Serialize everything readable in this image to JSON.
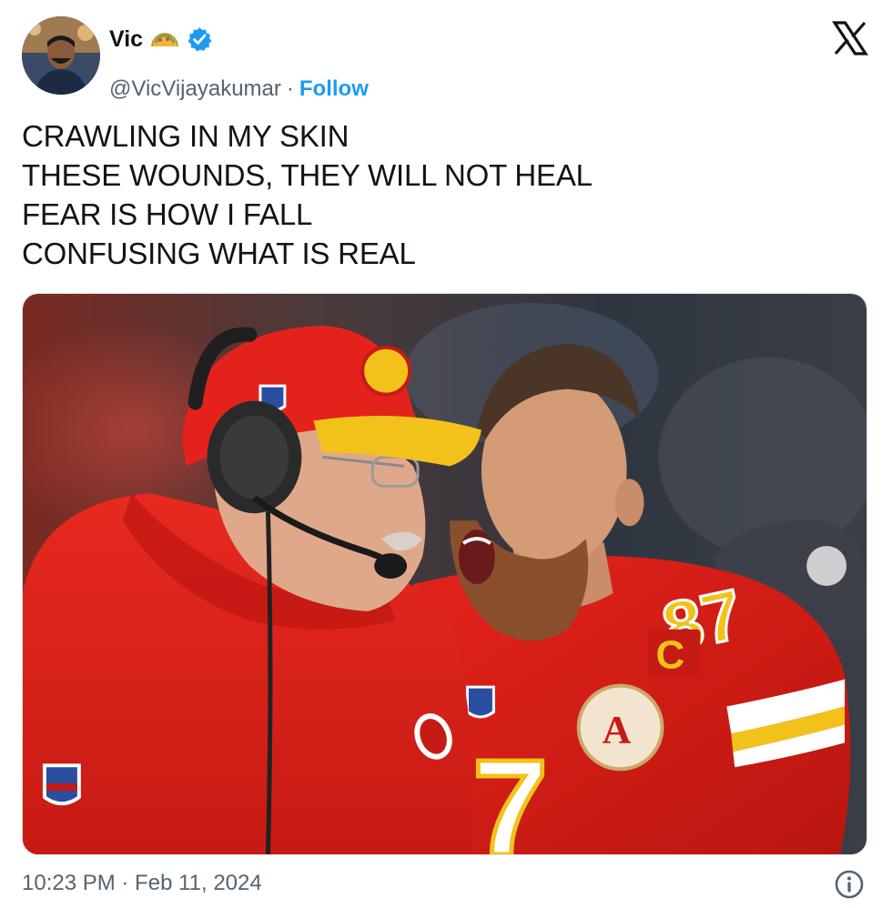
{
  "author": {
    "display_name": "Vic",
    "handle": "@VicVijayakumar",
    "separator": "·",
    "follow_label": "Follow",
    "emoji_icon": "taco-icon",
    "verified_icon": "verified-badge-icon",
    "avatar_icon": "profile-avatar"
  },
  "brand": {
    "logo_icon": "x-logo-icon",
    "follow_color": "#1d9bf0",
    "verified_color": "#1d9bf0",
    "secondary_text_color": "#536471"
  },
  "tweet": {
    "lines": [
      "CRAWLING IN MY SKIN",
      "THESE WOUNDS, THEY WILL NOT HEAL",
      "FEAR IS HOW I FALL",
      "CONFUSING WHAT IS REAL"
    ],
    "media_description_icon": "photo-media"
  },
  "footer": {
    "timestamp": "10:23 PM · Feb 11, 2024",
    "info_icon": "info-icon"
  }
}
